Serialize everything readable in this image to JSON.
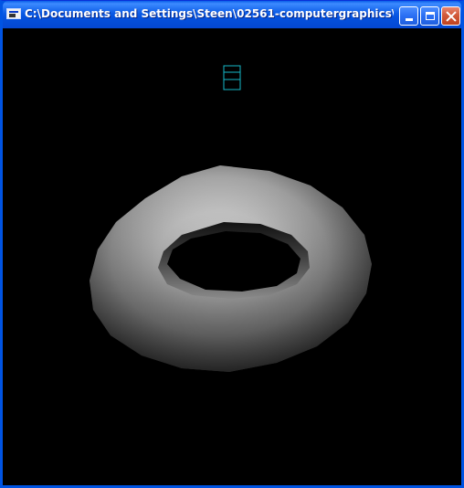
{
  "window": {
    "title": "C:\\Documents and Settings\\Steen\\02561-computergraphics\\ex...",
    "icon": "console-window-icon",
    "buttons": {
      "minimize": "minimize-icon",
      "maximize": "maximize-icon",
      "close": "close-icon"
    }
  },
  "viewport": {
    "background": "#000000",
    "objects": [
      {
        "name": "torus",
        "shading": "gray-gradient"
      },
      {
        "name": "small-wireframe-cube",
        "color": "#16b8c8"
      }
    ]
  }
}
